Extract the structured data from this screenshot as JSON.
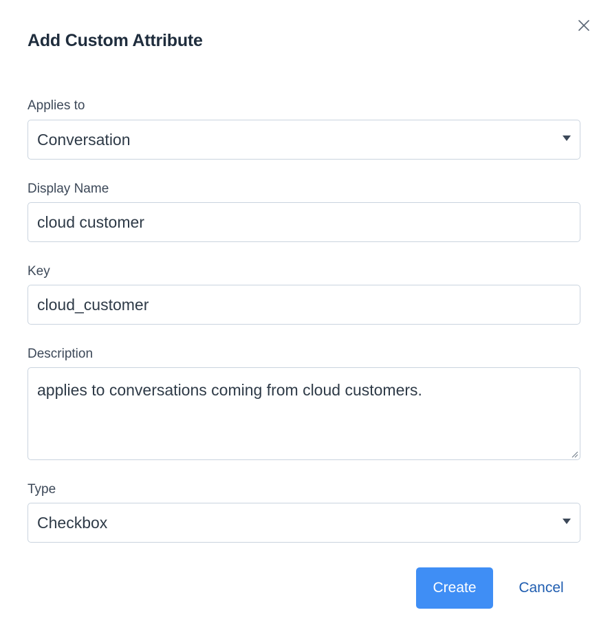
{
  "modal": {
    "title": "Add Custom Attribute",
    "close_icon": "close-icon"
  },
  "fields": {
    "applies_to": {
      "label": "Applies to",
      "value": "Conversation"
    },
    "display_name": {
      "label": "Display Name",
      "value": "cloud customer"
    },
    "key": {
      "label": "Key",
      "value": "cloud_customer"
    },
    "description": {
      "label": "Description",
      "value": "applies to conversations coming from cloud customers."
    },
    "type": {
      "label": "Type",
      "value": "Checkbox"
    }
  },
  "actions": {
    "create_label": "Create",
    "cancel_label": "Cancel"
  },
  "colors": {
    "primary": "#3f8ef5",
    "link": "#1f5db0",
    "border": "#c9d3de"
  }
}
